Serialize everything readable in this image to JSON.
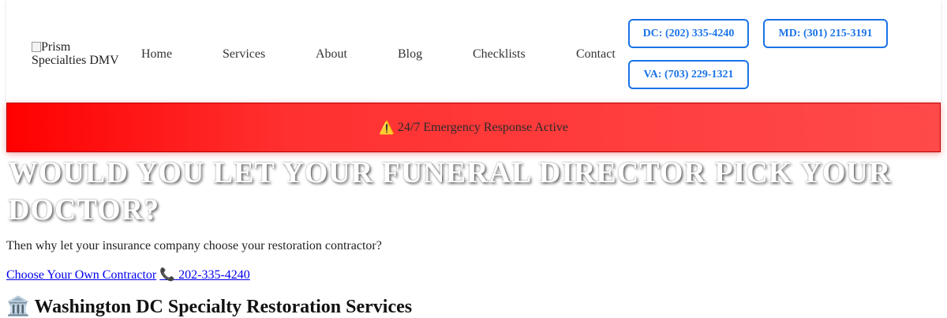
{
  "header": {
    "logo_alt": "Prism Specialties DMV",
    "nav": [
      {
        "label": "Home"
      },
      {
        "label": "Services"
      },
      {
        "label": "About"
      },
      {
        "label": "Blog"
      },
      {
        "label": "Checklists"
      },
      {
        "label": "Contact"
      }
    ],
    "phones": {
      "dc": "DC: (202) 335-4240",
      "md": "MD: (301) 215-3191",
      "va": "VA: (703) 229-1321"
    },
    "accent_color": "#1a73e8"
  },
  "banner": {
    "icon": "warning-icon",
    "text": "24/7 Emergency Response Active",
    "color": "#ff0000"
  },
  "hero": {
    "title": "WOULD YOU LET YOUR FUNERAL DIRECTOR PICK YOUR DOCTOR?",
    "subtitle": "Then why let your insurance company choose your restoration contractor?",
    "cta_label": "Choose Your Own Contractor",
    "phone_icon": "phone-icon",
    "phone_label": " 202-335-4240"
  },
  "section": {
    "icon": "classical-building-icon",
    "title": "Washington DC Specialty Restoration Services"
  }
}
